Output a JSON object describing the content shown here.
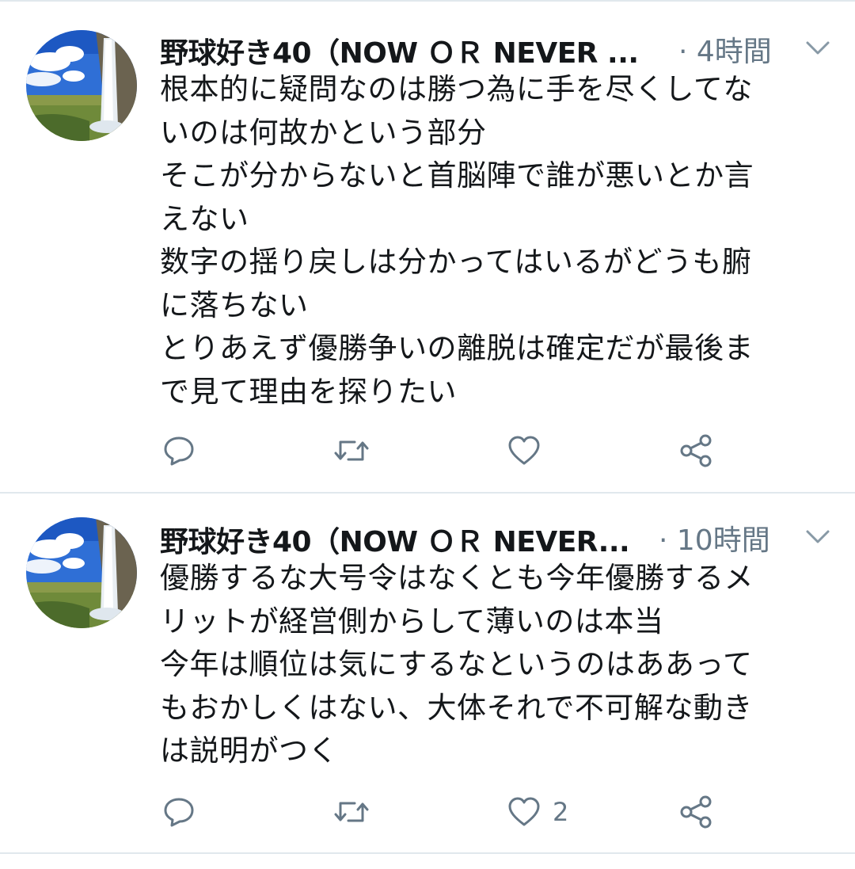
{
  "tweets": [
    {
      "author_name": "野球好き40（NOW ＯＲ NEVER ...",
      "separator": "·",
      "time": "4時間",
      "text_lines": [
        "根本的に疑問なのは勝つ為に手を尽くしてな",
        "いのは何故かという部分",
        "そこが分からないと首脳陣で誰が悪いとか言",
        "えない",
        "数字の揺り戻しは分かってはいるがどうも腑",
        "に落ちない",
        "とりあえず優勝争いの離脱は確定だが最後ま",
        "で見て理由を探りたい"
      ],
      "like_count": "",
      "icons": {
        "reply": "reply-icon",
        "retweet": "retweet-icon",
        "like": "heart-icon",
        "share": "share-icon",
        "menu": "chevron-down-icon"
      }
    },
    {
      "author_name": "野球好き40（NOW ＯＲ NEVER...",
      "separator": "·",
      "time": "10時間",
      "text_lines": [
        "優勝するな大号令はなくとも今年優勝するメ",
        "リットが経営側からして薄いのは本当",
        "今年は順位は気にするなというのはああって",
        "もおかしくはない、大体それで不可解な動き",
        "は説明がつく"
      ],
      "like_count": "2",
      "icons": {
        "reply": "reply-icon",
        "retweet": "retweet-icon",
        "like": "heart-icon",
        "share": "share-icon",
        "menu": "chevron-down-icon"
      }
    }
  ],
  "colors": {
    "text": "#14171a",
    "secondary": "#657786",
    "divider": "#e1e8ed",
    "icon": "#657786"
  }
}
